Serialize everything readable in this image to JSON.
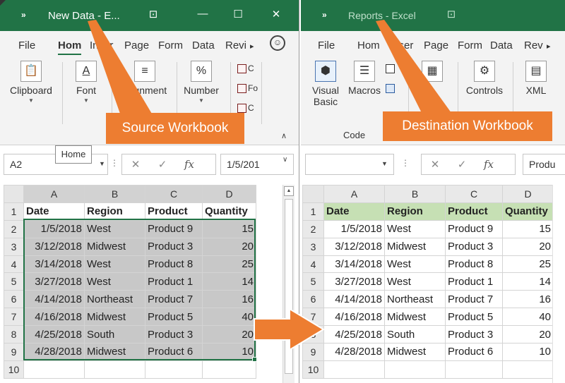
{
  "source_window": {
    "title": "New Data  -  E...",
    "quick_access": "»",
    "controls": [
      "⊡",
      "—",
      "☐",
      "✕"
    ],
    "tabs": [
      "File",
      "Hom",
      "Inser",
      "Page",
      "Form",
      "Data",
      "Revi"
    ],
    "tab_scroll": "▸",
    "smiley": "☺",
    "ribbon": {
      "clipboard": "Clipboard",
      "font": "Font",
      "alignment": "Alignment",
      "number": "Number",
      "mini_cond": "C",
      "mini_fmt": "Fo",
      "mini_cell": "C",
      "collapse": "∧"
    },
    "tooltip": "Home",
    "name_box": "A2",
    "formula_value": "1/5/201",
    "fx": "fx",
    "cancel": "✕",
    "confirm": "✓",
    "columns": [
      "A",
      "B",
      "C",
      "D"
    ],
    "header_row": [
      "Date",
      "Region",
      "Product",
      "Quantity"
    ]
  },
  "dest_window": {
    "title": "Reports  -  Excel",
    "quick_access": "»",
    "controls": [
      "⊡"
    ],
    "tabs": [
      "File",
      "Hom",
      "Inser",
      "Page",
      "Form",
      "Data",
      "Rev"
    ],
    "tab_scroll": "▸",
    "ribbon": {
      "visual_basic_1": "Visual",
      "visual_basic_2": "Basic",
      "macros": "Macros",
      "controls": "Controls",
      "xml": "XML",
      "group_code": "Code"
    },
    "name_box": "",
    "formula_value": "Produ",
    "fx": "fx",
    "cancel": "✕",
    "confirm": "✓",
    "columns": [
      "A",
      "B",
      "C",
      "D"
    ],
    "header_row": [
      "Date",
      "Region",
      "Product",
      "Quantity"
    ]
  },
  "data_rows": [
    [
      "1/5/2018",
      "West",
      "Product 9",
      "15"
    ],
    [
      "3/12/2018",
      "Midwest",
      "Product 3",
      "20"
    ],
    [
      "3/14/2018",
      "West",
      "Product 8",
      "25"
    ],
    [
      "3/27/2018",
      "West",
      "Product 1",
      "14"
    ],
    [
      "4/14/2018",
      "Northeast",
      "Product 7",
      "16"
    ],
    [
      "4/16/2018",
      "Midwest",
      "Product 5",
      "40"
    ],
    [
      "4/25/2018",
      "South",
      "Product 3",
      "20"
    ],
    [
      "4/28/2018",
      "Midwest",
      "Product 6",
      "10"
    ]
  ],
  "row_numbers": [
    "1",
    "2",
    "3",
    "4",
    "5",
    "6",
    "7",
    "8",
    "9",
    "10"
  ],
  "callouts": {
    "source": "Source Workbook",
    "destination": "Destination Workbook"
  },
  "colors": {
    "excel_green": "#217346",
    "callout_orange": "#ed7d31",
    "header_fill": "#c6e0b4",
    "selection_fill": "#c8c8c8"
  }
}
